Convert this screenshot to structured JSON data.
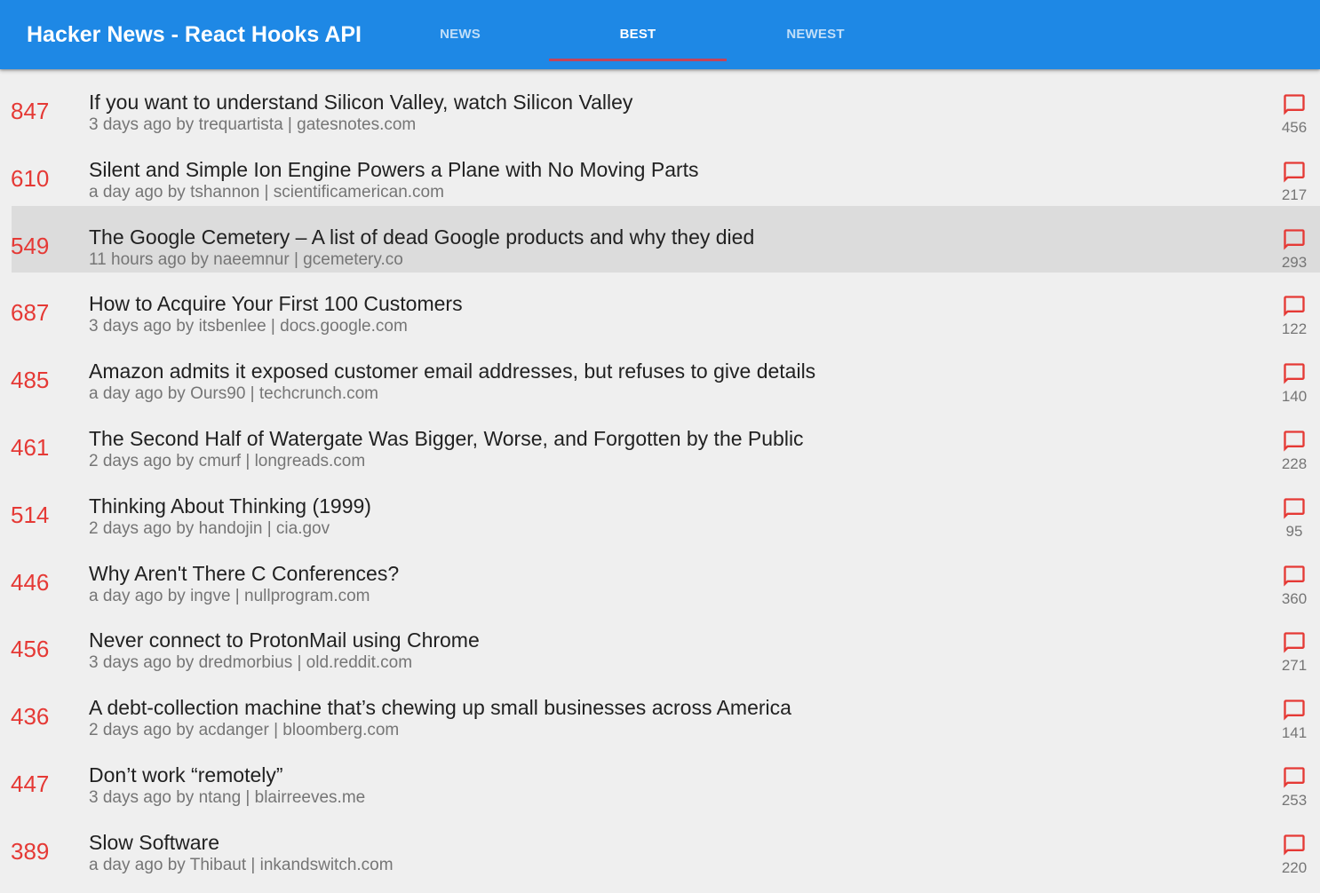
{
  "app": {
    "title": "Hacker News - React Hooks API"
  },
  "tabs": [
    {
      "label": "NEWS",
      "active": false
    },
    {
      "label": "BEST",
      "active": true
    },
    {
      "label": "NEWEST",
      "active": false
    }
  ],
  "colors": {
    "appbar": "#1e88e5",
    "accent": "#e53935",
    "tab_indicator": "#c2445c",
    "selected_row": "#dcdcdc"
  },
  "stories": [
    {
      "score": "847",
      "title": "If you want to understand Silicon Valley, watch Silicon Valley",
      "meta": "3 days ago by trequartista | gatesnotes.com",
      "comments": "456",
      "icon": "comment-icon"
    },
    {
      "score": "610",
      "title": "Silent and Simple Ion Engine Powers a Plane with No Moving Parts",
      "meta": "a day ago by tshannon | scientificamerican.com",
      "comments": "217",
      "icon": "comment-icon"
    },
    {
      "score": "549",
      "title": "The Google Cemetery – A list of dead Google products and why they died",
      "meta": "11 hours ago by naeemnur | gcemetery.co",
      "comments": "293",
      "icon": "comment-icon",
      "selected": true
    },
    {
      "score": "687",
      "title": "How to Acquire Your First 100 Customers",
      "meta": "3 days ago by itsbenlee | docs.google.com",
      "comments": "122",
      "icon": "comment-icon"
    },
    {
      "score": "485",
      "title": "Amazon admits it exposed customer email addresses, but refuses to give details",
      "meta": "a day ago by Ours90 | techcrunch.com",
      "comments": "140",
      "icon": "comment-icon"
    },
    {
      "score": "461",
      "title": "The Second Half of Watergate Was Bigger, Worse, and Forgotten by the Public",
      "meta": "2 days ago by cmurf | longreads.com",
      "comments": "228",
      "icon": "comment-icon"
    },
    {
      "score": "514",
      "title": "Thinking About Thinking (1999)",
      "meta": "2 days ago by handojin | cia.gov",
      "comments": "95",
      "icon": "comment-icon"
    },
    {
      "score": "446",
      "title": "Why Aren't There C Conferences?",
      "meta": "a day ago by ingve | nullprogram.com",
      "comments": "360",
      "icon": "comment-icon"
    },
    {
      "score": "456",
      "title": "Never connect to ProtonMail using Chrome",
      "meta": "3 days ago by dredmorbius | old.reddit.com",
      "comments": "271",
      "icon": "comment-icon"
    },
    {
      "score": "436",
      "title": "A debt-collection machine that’s chewing up small businesses across America",
      "meta": "2 days ago by acdanger | bloomberg.com",
      "comments": "141",
      "icon": "comment-icon"
    },
    {
      "score": "447",
      "title": "Don’t work “remotely”",
      "meta": "3 days ago by ntang | blairreeves.me",
      "comments": "253",
      "icon": "comment-icon"
    },
    {
      "score": "389",
      "title": "Slow Software",
      "meta": "a day ago by Thibaut | inkandswitch.com",
      "comments": "220",
      "icon": "comment-icon"
    }
  ]
}
